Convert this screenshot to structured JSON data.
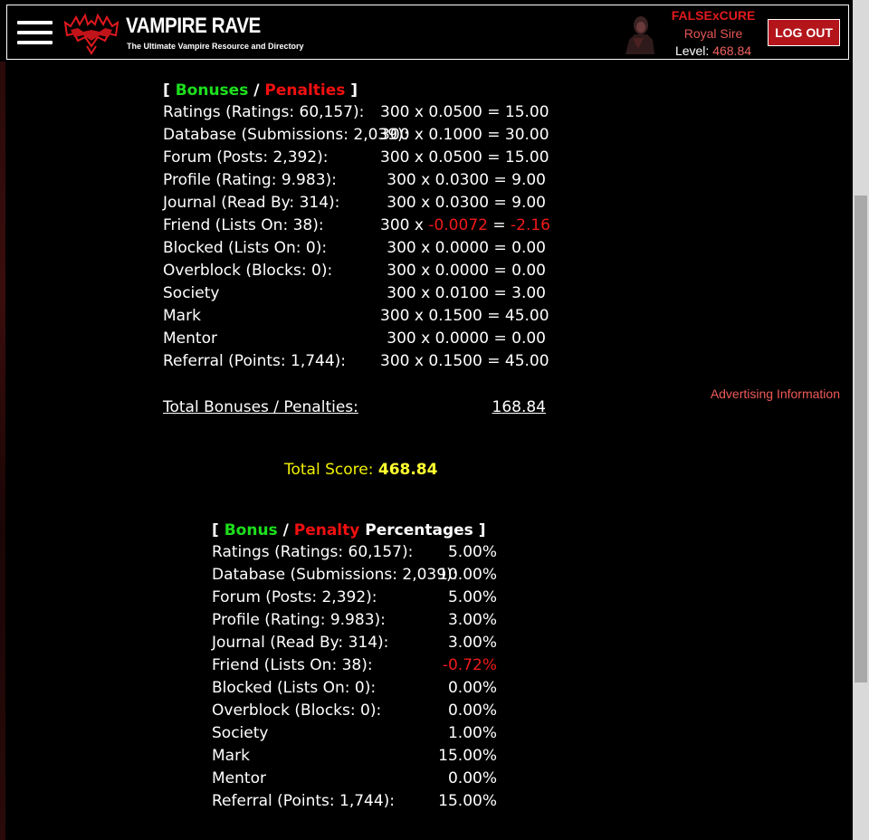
{
  "header": {
    "logo_title": "VAMPIRE RAVE",
    "logo_tagline": "The Ultimate Vampire Resource and Directory",
    "user_name": "FALSExCURE",
    "user_rank": "Royal Sire",
    "level_label": "Level:",
    "level_value": "468.84",
    "logout_label": "LOG OUT"
  },
  "bonuses": {
    "open_bracket": "[",
    "bonuses_word": "Bonuses",
    "slash": "/",
    "penalties_word": "Penalties",
    "close_bracket": "]",
    "rows": [
      {
        "label": "Ratings (Ratings: 60,157):",
        "base": "300 x ",
        "factor": "0.0500",
        "eq": " = ",
        "result": "15.00"
      },
      {
        "label": "Database (Submissions: 2,039):",
        "base": "300 x ",
        "factor": "0.1000",
        "eq": " = ",
        "result": "30.00"
      },
      {
        "label": "Forum (Posts: 2,392):",
        "base": "300 x ",
        "factor": "0.0500",
        "eq": " = ",
        "result": "15.00"
      },
      {
        "label": "Profile (Rating: 9.983):",
        "base": "300 x ",
        "factor": "0.0300",
        "eq": " = ",
        "result": "9.00"
      },
      {
        "label": "Journal (Read By: 314):",
        "base": "300 x ",
        "factor": "0.0300",
        "eq": " = ",
        "result": "9.00"
      },
      {
        "label": "Friend (Lists On: 38):",
        "base": "300 x ",
        "factor": "-0.0072",
        "eq": " = ",
        "result": "-2.16"
      },
      {
        "label": "Blocked (Lists On: 0):",
        "base": "300 x ",
        "factor": "0.0000",
        "eq": " = ",
        "result": "0.00"
      },
      {
        "label": "Overblock (Blocks: 0):",
        "base": "300 x ",
        "factor": "0.0000",
        "eq": " = ",
        "result": "0.00"
      },
      {
        "label": "Society",
        "base": "300 x ",
        "factor": "0.0100",
        "eq": " = ",
        "result": "3.00"
      },
      {
        "label": "Mark",
        "base": "300 x ",
        "factor": "0.1500",
        "eq": " = ",
        "result": "45.00"
      },
      {
        "label": "Mentor",
        "base": "300 x ",
        "factor": "0.0000",
        "eq": " = ",
        "result": "0.00"
      },
      {
        "label": "Referral (Points: 1,744):",
        "base": "300 x ",
        "factor": "0.1500",
        "eq": " = ",
        "result": "45.00"
      }
    ],
    "total_label": "Total Bonuses / Penalties:",
    "total_value": "168.84"
  },
  "advertising_link": "Advertising Information",
  "total_score": {
    "label": "Total Score:",
    "value": "468.84"
  },
  "percentages": {
    "open_bracket": "[",
    "bonus_word": "Bonus",
    "slash": "/",
    "penalty_word": "Penalty",
    "percentages_word": "Percentages",
    "close_bracket": "]",
    "rows": [
      {
        "label": "Ratings (Ratings: 60,157):",
        "value": "5.00%"
      },
      {
        "label": "Database (Submissions: 2,039):",
        "value": "10.00%"
      },
      {
        "label": "Forum (Posts: 2,392):",
        "value": "5.00%"
      },
      {
        "label": "Profile (Rating: 9.983):",
        "value": "3.00%"
      },
      {
        "label": "Journal (Read By: 314):",
        "value": "3.00%"
      },
      {
        "label": "Friend (Lists On: 38):",
        "value": "-0.72%"
      },
      {
        "label": "Blocked (Lists On: 0):",
        "value": "0.00%"
      },
      {
        "label": "Overblock (Blocks: 0):",
        "value": "0.00%"
      },
      {
        "label": "Society",
        "value": "1.00%"
      },
      {
        "label": "Mark",
        "value": "15.00%"
      },
      {
        "label": "Mentor",
        "value": "0.00%"
      },
      {
        "label": "Referral (Points: 1,744):",
        "value": "15.00%"
      }
    ]
  },
  "colors": {
    "background": "#000000",
    "bonus_green": "#1de01d",
    "penalty_red": "#f01010",
    "score_yellow": "#ffff30",
    "logout_red": "#b3151b"
  },
  "icons": {
    "menu": "hamburger-icon",
    "logo": "bat-wings-logo",
    "avatar": "user-avatar"
  }
}
